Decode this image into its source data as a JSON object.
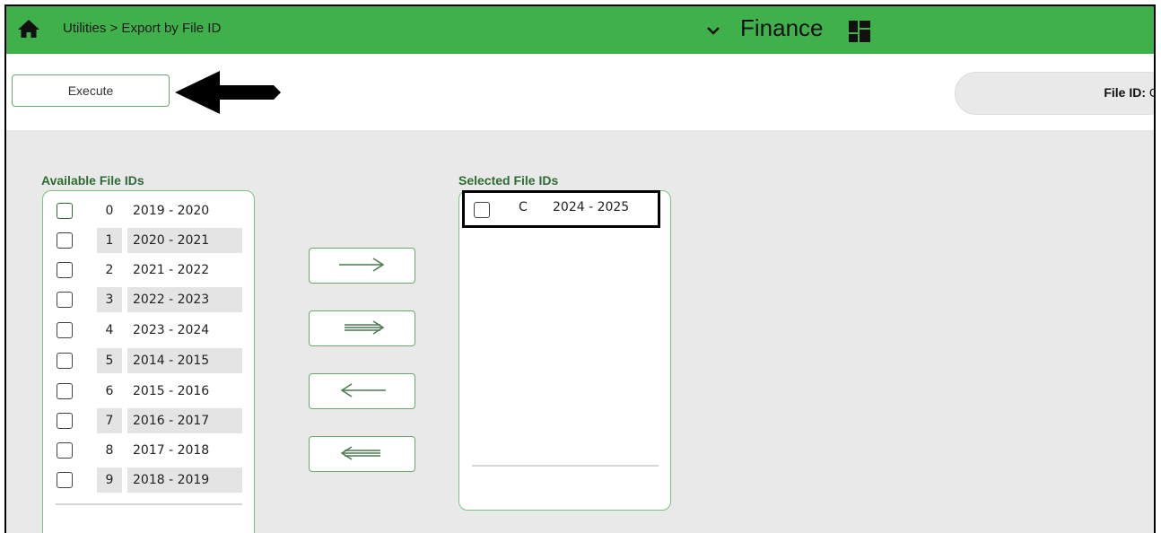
{
  "header": {
    "breadcrumb": "Utilities > Export by File ID",
    "app_title": "Finance"
  },
  "toolbar": {
    "execute_label": "Execute",
    "file_id_label": "File ID:",
    "file_id_value": "C"
  },
  "available": {
    "label": "Available File IDs",
    "items": [
      {
        "id": "0",
        "years": "2019 - 2020"
      },
      {
        "id": "1",
        "years": "2020 - 2021"
      },
      {
        "id": "2",
        "years": "2021 - 2022"
      },
      {
        "id": "3",
        "years": "2022 - 2023"
      },
      {
        "id": "4",
        "years": "2023 - 2024"
      },
      {
        "id": "5",
        "years": "2014 - 2015"
      },
      {
        "id": "6",
        "years": "2015 - 2016"
      },
      {
        "id": "7",
        "years": "2016 - 2017"
      },
      {
        "id": "8",
        "years": "2017 - 2018"
      },
      {
        "id": "9",
        "years": "2018 - 2019"
      }
    ]
  },
  "selected": {
    "label": "Selected File IDs",
    "items": [
      {
        "id": "C",
        "years": "2024 - 2025"
      }
    ]
  },
  "colors": {
    "header_green": "#40b14a",
    "accent_green": "#2f6b34",
    "border_green": "#7cc282",
    "background": "#e9e9e9"
  }
}
